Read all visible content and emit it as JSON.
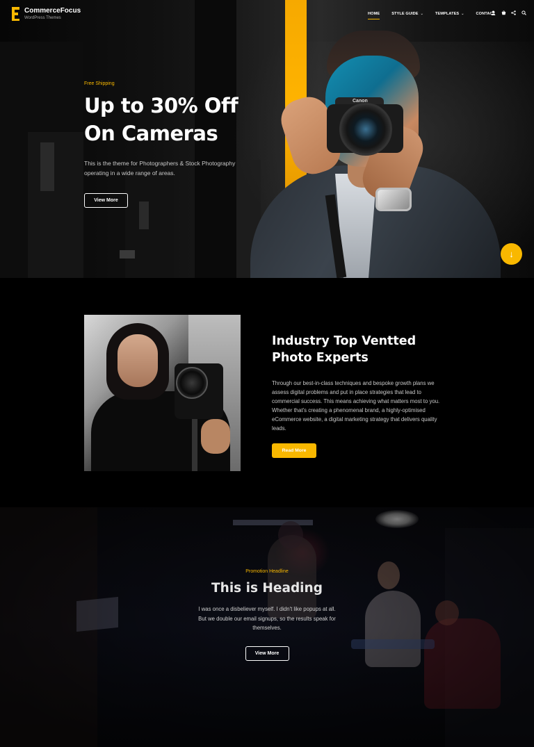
{
  "header": {
    "logo": {
      "name": "CommerceFocus",
      "tagline": "WordPress Themes"
    },
    "nav": [
      {
        "label": "HOME",
        "active": true,
        "has_dropdown": false
      },
      {
        "label": "STYLE GUIDE",
        "active": false,
        "has_dropdown": true
      },
      {
        "label": "TEMPLATES",
        "active": false,
        "has_dropdown": true
      },
      {
        "label": "CONTACT",
        "active": false,
        "has_dropdown": false
      }
    ],
    "icons": [
      "user-icon",
      "cart-icon",
      "share-icon",
      "search-icon"
    ]
  },
  "hero": {
    "eyebrow": "Free Shipping",
    "title_line1": "Up to 30% Off",
    "title_line2": "On Cameras",
    "description": "This is the theme for Photographers & Stock Photography operating in a wide range of areas.",
    "button": "View More",
    "camera_brand": "Canon",
    "scroll_icon": "arrow-down-icon"
  },
  "about": {
    "title_line1": "Industry Top Ventted",
    "title_line2": "Photo Experts",
    "body": "Through our best-in-class techniques and bespoke growth plans we assess digital problems and put in place strategies that lead to commercial success. This means achieving what matters most to you. Whether that's creating a phenomenal brand, a highly-optimised eCommerce website, a digital marketing strategy that delivers quality leads.",
    "button": "Read More"
  },
  "promo": {
    "eyebrow": "Promotion Headline",
    "title": "This is Heading",
    "body": "I was once a disbeliever myself. I didn't like popups at all. But we double our email signups, so the results speak for themselves.",
    "button": "View More"
  },
  "colors": {
    "accent": "#f9b800",
    "background": "#000000"
  }
}
